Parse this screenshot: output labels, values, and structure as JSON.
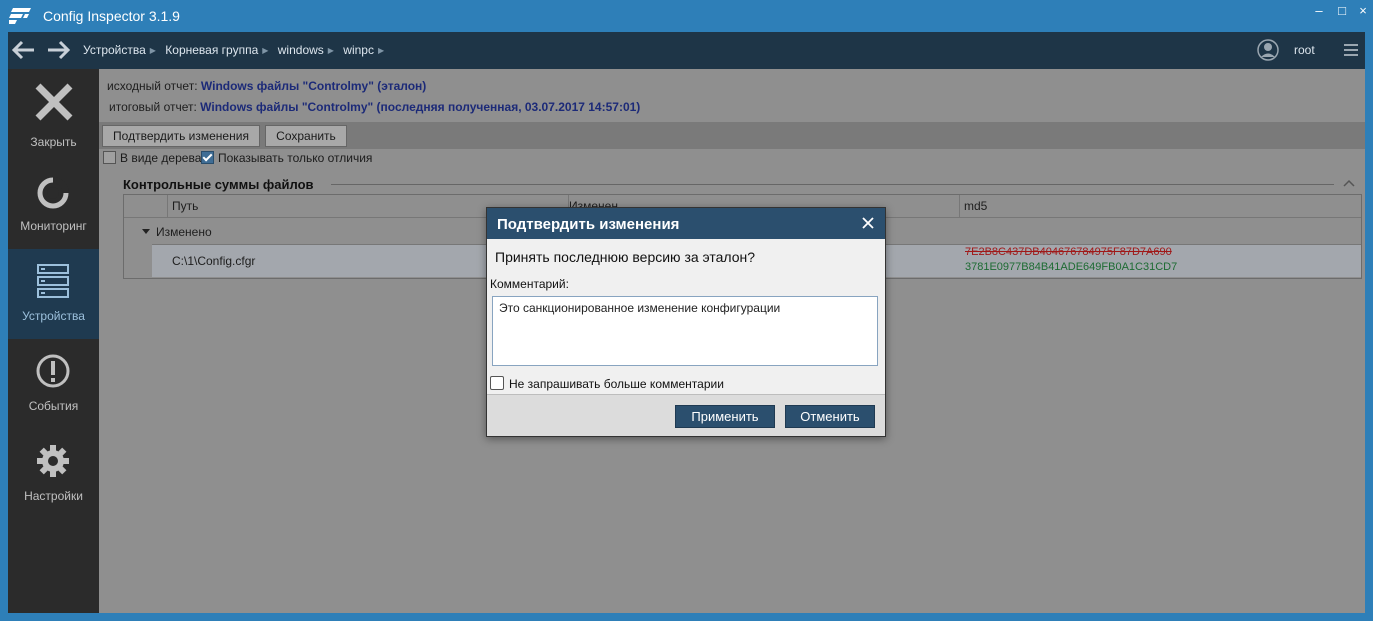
{
  "app": {
    "title": "Config Inspector 3.1.9"
  },
  "window_controls": {
    "minimize": "–",
    "maximize": "□",
    "close": "×"
  },
  "breadcrumbs": [
    "Устройства",
    "Корневая группа",
    "windows",
    "winpc"
  ],
  "user": {
    "name": "root"
  },
  "sidebar": {
    "items": [
      {
        "label": "Закрыть",
        "icon": "close-icon",
        "active": false
      },
      {
        "label": "Мониторинг",
        "icon": "monitoring-icon",
        "active": false
      },
      {
        "label": "Устройства",
        "icon": "server-icon",
        "active": true
      },
      {
        "label": "События",
        "icon": "alert-icon",
        "active": false
      },
      {
        "label": "Настройки",
        "icon": "gear-icon",
        "active": false
      }
    ]
  },
  "report": {
    "source_label": "исходный отчет:",
    "source_value": "Windows файлы \"Controlmy\" (эталон)",
    "result_label": "итоговый отчет:",
    "result_value": "Windows файлы \"Controlmy\" (последняя полученная, 03.07.2017 14:57:01)"
  },
  "buttons": {
    "confirm_changes": "Подтвердить изменения",
    "save": "Сохранить"
  },
  "options": {
    "tree_view": "В виде дерева",
    "tree_view_checked": false,
    "only_diff": "Показывать только отличия",
    "only_diff_checked": true
  },
  "section": {
    "title": "Контрольные суммы файлов"
  },
  "grid": {
    "columns": [
      "Путь",
      "Изменен",
      "md5"
    ],
    "group_label": "Изменено",
    "rows": [
      {
        "path": "C:\\1\\Config.cfgr",
        "md5_old": "7E2B8C437DB404676784975F87D7A690",
        "md5_new": "3781E0977B84B41ADE649FB0A1C31CD7"
      }
    ]
  },
  "dialog": {
    "title": "Подтвердить изменения",
    "question": "Принять последнюю версию за эталон?",
    "comment_label": "Комментарий:",
    "comment_value": "Это санкционированное изменение конфигурации",
    "no_ask_label": "Не запрашивать больше комментарии",
    "no_ask_checked": false,
    "apply": "Применить",
    "cancel": "Отменить"
  },
  "colors": {
    "accent": "#2b4f6e",
    "window_frame": "#2e7fb8",
    "md5_old": "#a01818",
    "md5_new": "#1d6b33"
  }
}
